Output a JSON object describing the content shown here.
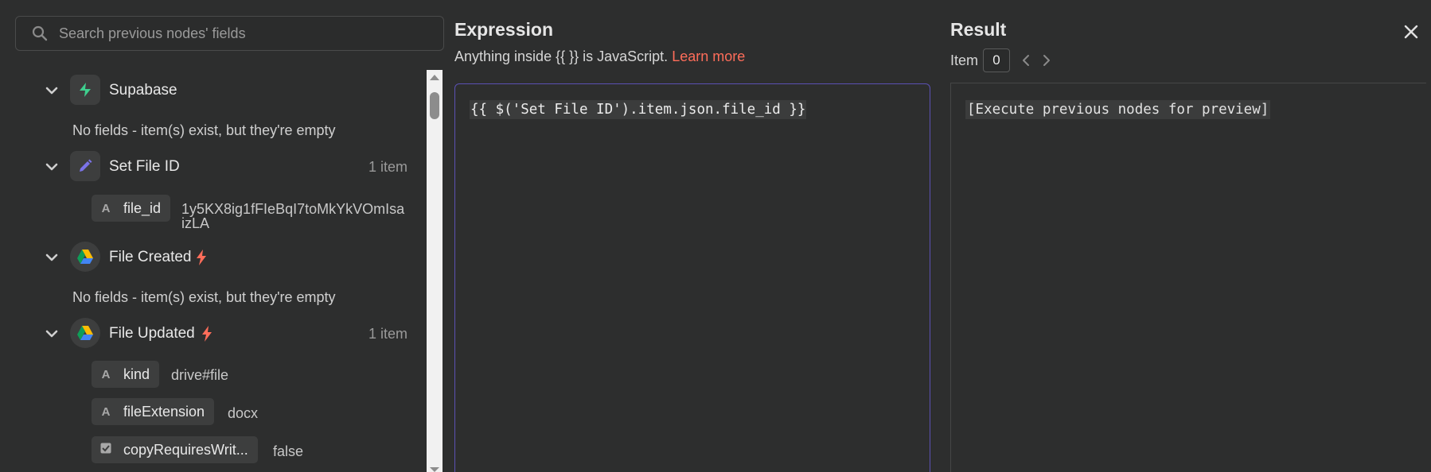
{
  "search": {
    "placeholder": "Search previous nodes' fields"
  },
  "nodes": [
    {
      "title": "Supabase",
      "count": "",
      "icon": "supabase-icon",
      "empty_text": "No fields - item(s) exist, but they're empty"
    },
    {
      "title": "Set File ID",
      "count": "1 item",
      "icon": "pencil-icon",
      "fields": [
        {
          "type": "string",
          "name": "file_id",
          "value_line1": "1y5KX8ig1fFIeBqI7toMkYkVOmIsa",
          "value_line2": "izLA"
        }
      ]
    },
    {
      "title": "File Created",
      "count": "",
      "icon": "google-drive-icon",
      "trigger": true,
      "empty_text": "No fields - item(s) exist, but they're empty"
    },
    {
      "title": "File Updated",
      "count": "1 item",
      "icon": "google-drive-icon",
      "trigger": true,
      "fields": [
        {
          "type": "string",
          "name": "kind",
          "value": "drive#file"
        },
        {
          "type": "string",
          "name": "fileExtension",
          "value": "docx"
        },
        {
          "type": "boolean",
          "name": "copyRequiresWrit...",
          "value": "false"
        }
      ]
    }
  ],
  "type_glyphs": {
    "string": "A"
  },
  "expression": {
    "title": "Expression",
    "hint_prefix": "Anything inside {{  }} is JavaScript.",
    "learn_more": "Learn more",
    "code": "{{ $('Set File ID').item.json.file_id }}"
  },
  "result": {
    "title": "Result",
    "item_label": "Item",
    "item_index": "0",
    "output": "[Execute previous nodes for preview]"
  },
  "colors": {
    "accent_link": "#ff6d5a",
    "editor_border": "#5b51b3",
    "trigger_bolt": "#ff6d5a",
    "supabase_green": "#3ecf8e",
    "pencil_purple": "#7b73e8"
  }
}
